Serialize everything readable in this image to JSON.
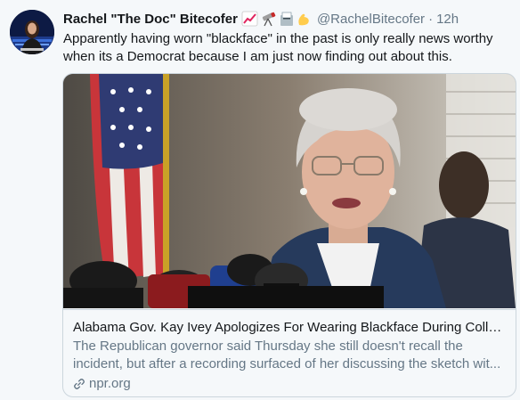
{
  "tweet": {
    "display_name": "Rachel \"The Doc\" Bitecofer",
    "emojis": [
      "chart-increasing-icon",
      "telescope-icon",
      "ballot-box-icon",
      "flexed-biceps-icon"
    ],
    "handle": "@RachelBitecofer",
    "separator": "·",
    "time": "12h",
    "text": "Apparently having worn \"blackface\" in the past is only really news worthy when its a Democrat because I am just now finding out about this."
  },
  "card": {
    "image_description": "photo-of-speaker-at-microphones-with-flag",
    "title": "Alabama Gov. Kay Ivey Apologizes For Wearing Blackface During Colleg...",
    "description": "The Republican governor said Thursday she still doesn't recall the incident, but after a recording surfaced of her discussing the sketch wit...",
    "domain": "npr.org",
    "domain_icon": "link-icon"
  },
  "colors": {
    "text_primary": "#14171a",
    "text_secondary": "#657786",
    "border": "#ccd6dd",
    "background": "#f5f8fa"
  }
}
